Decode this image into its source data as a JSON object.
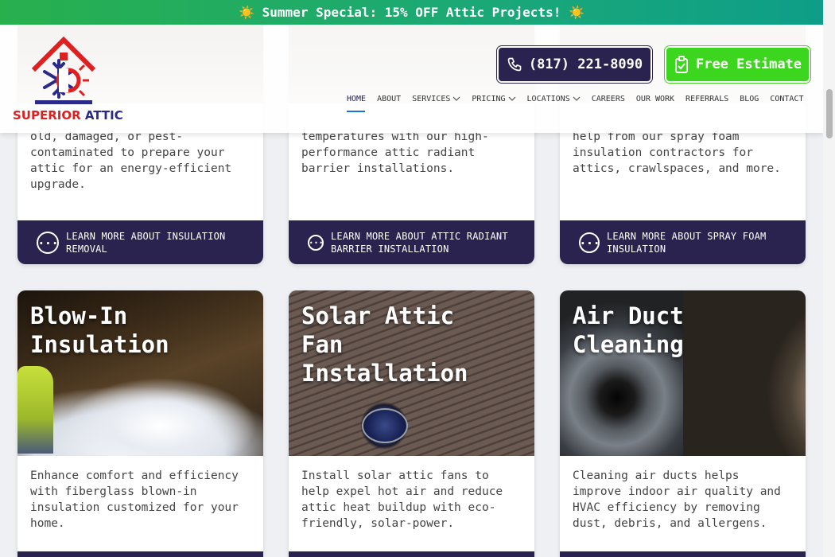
{
  "banner": {
    "text": "☀️ Summer Special: 15% OFF Attic Projects! ☀️"
  },
  "header": {
    "logo_alt": "Superior Attic",
    "logo_word1": "SUPERIOR",
    "logo_word2": "ATTIC",
    "phone": "(817) 221-8090",
    "estimate": "Free Estimate"
  },
  "nav": {
    "items": [
      {
        "label": "HOME"
      },
      {
        "label": "ABOUT"
      },
      {
        "label": "SERVICES"
      },
      {
        "label": "PRICING"
      },
      {
        "label": "LOCATIONS"
      },
      {
        "label": "CAREERS"
      },
      {
        "label": "OUR WORK"
      },
      {
        "label": "REFERRALS"
      },
      {
        "label": "BLOG"
      },
      {
        "label": "CONTACT"
      }
    ]
  },
  "top_cards": [
    {
      "desc": "old, damaged, or pest-contaminated to prepare your attic for an energy-efficient upgrade.",
      "cta": "LEARN MORE ABOUT INSULATION REMOVAL"
    },
    {
      "desc": "temperatures with our high-performance attic radiant barrier installations.",
      "cta": "LEARN MORE ABOUT ATTIC RADIANT BARRIER INSTALLATION"
    },
    {
      "desc": "help from our spray foam insulation contractors for attics, crawlspaces, and more.",
      "cta": "LEARN MORE ABOUT SPRAY FOAM INSULATION"
    }
  ],
  "bottom_cards": [
    {
      "title": "Blow-In Insulation",
      "desc": "Enhance comfort and efficiency with fiberglass blown-in insulation customized for your home."
    },
    {
      "title": "Solar Attic Fan Installation",
      "desc": "Install solar attic fans to help expel hot air and reduce attic heat buildup with eco-friendly, solar-power."
    },
    {
      "title": "Air Duct Cleaning",
      "desc": "Cleaning air ducts helps improve indoor air quality and HVAC efficiency by removing dust, debris, and allergens."
    }
  ],
  "icons": {
    "phone": "phone-icon",
    "estimate": "clipboard-check-icon",
    "more": "more-dots-icon",
    "chevron": "chevron-down-icon"
  }
}
